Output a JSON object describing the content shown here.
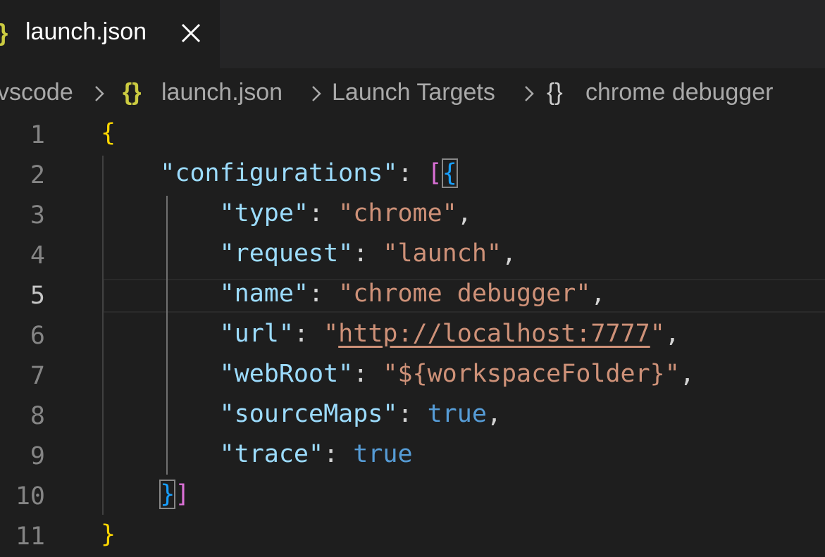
{
  "tab": {
    "icon": "}",
    "title": "launch.json",
    "close_icon": "close-icon"
  },
  "breadcrumb": [
    {
      "label": "vscode"
    },
    {
      "icon": "{}",
      "label": "launch.json"
    },
    {
      "label": "Launch Targets"
    },
    {
      "icon": "{}",
      "label": "chrome debugger"
    }
  ],
  "editor": {
    "active_line": 5,
    "line_numbers": [
      "1",
      "2",
      "3",
      "4",
      "5",
      "6",
      "7",
      "8",
      "9",
      "10",
      "11"
    ],
    "open_brace": "{",
    "configurations_key": "\"configurations\"",
    "open_array": "[",
    "open_obj": "{",
    "entries": [
      {
        "key": "\"type\"",
        "value": "\"chrome\"",
        "sep": ","
      },
      {
        "key": "\"request\"",
        "value": "\"launch\"",
        "sep": ","
      },
      {
        "key": "\"name\"",
        "value": "\"chrome debugger\"",
        "sep": ","
      },
      {
        "key": "\"url\"",
        "value_open": "\"",
        "value_link": "http://localhost:7777",
        "value_close": "\"",
        "sep": ","
      },
      {
        "key": "\"webRoot\"",
        "value": "\"${workspaceFolder}\"",
        "sep": ","
      },
      {
        "key": "\"sourceMaps\"",
        "value": "true",
        "sep": ","
      },
      {
        "key": "\"trace\"",
        "value": "true",
        "sep": ""
      }
    ],
    "close_obj": "}",
    "close_array": "]",
    "close_brace": "}",
    "colon": ": "
  },
  "colors": {
    "background": "#1e1e1e",
    "tabbar": "#252526",
    "json_key": "#9cdcfe",
    "json_string": "#ce9178",
    "json_boolean": "#569cd6",
    "bracket_gold": "#ffd700",
    "bracket_orchid": "#da70d6",
    "bracket_blue": "#179fff"
  }
}
